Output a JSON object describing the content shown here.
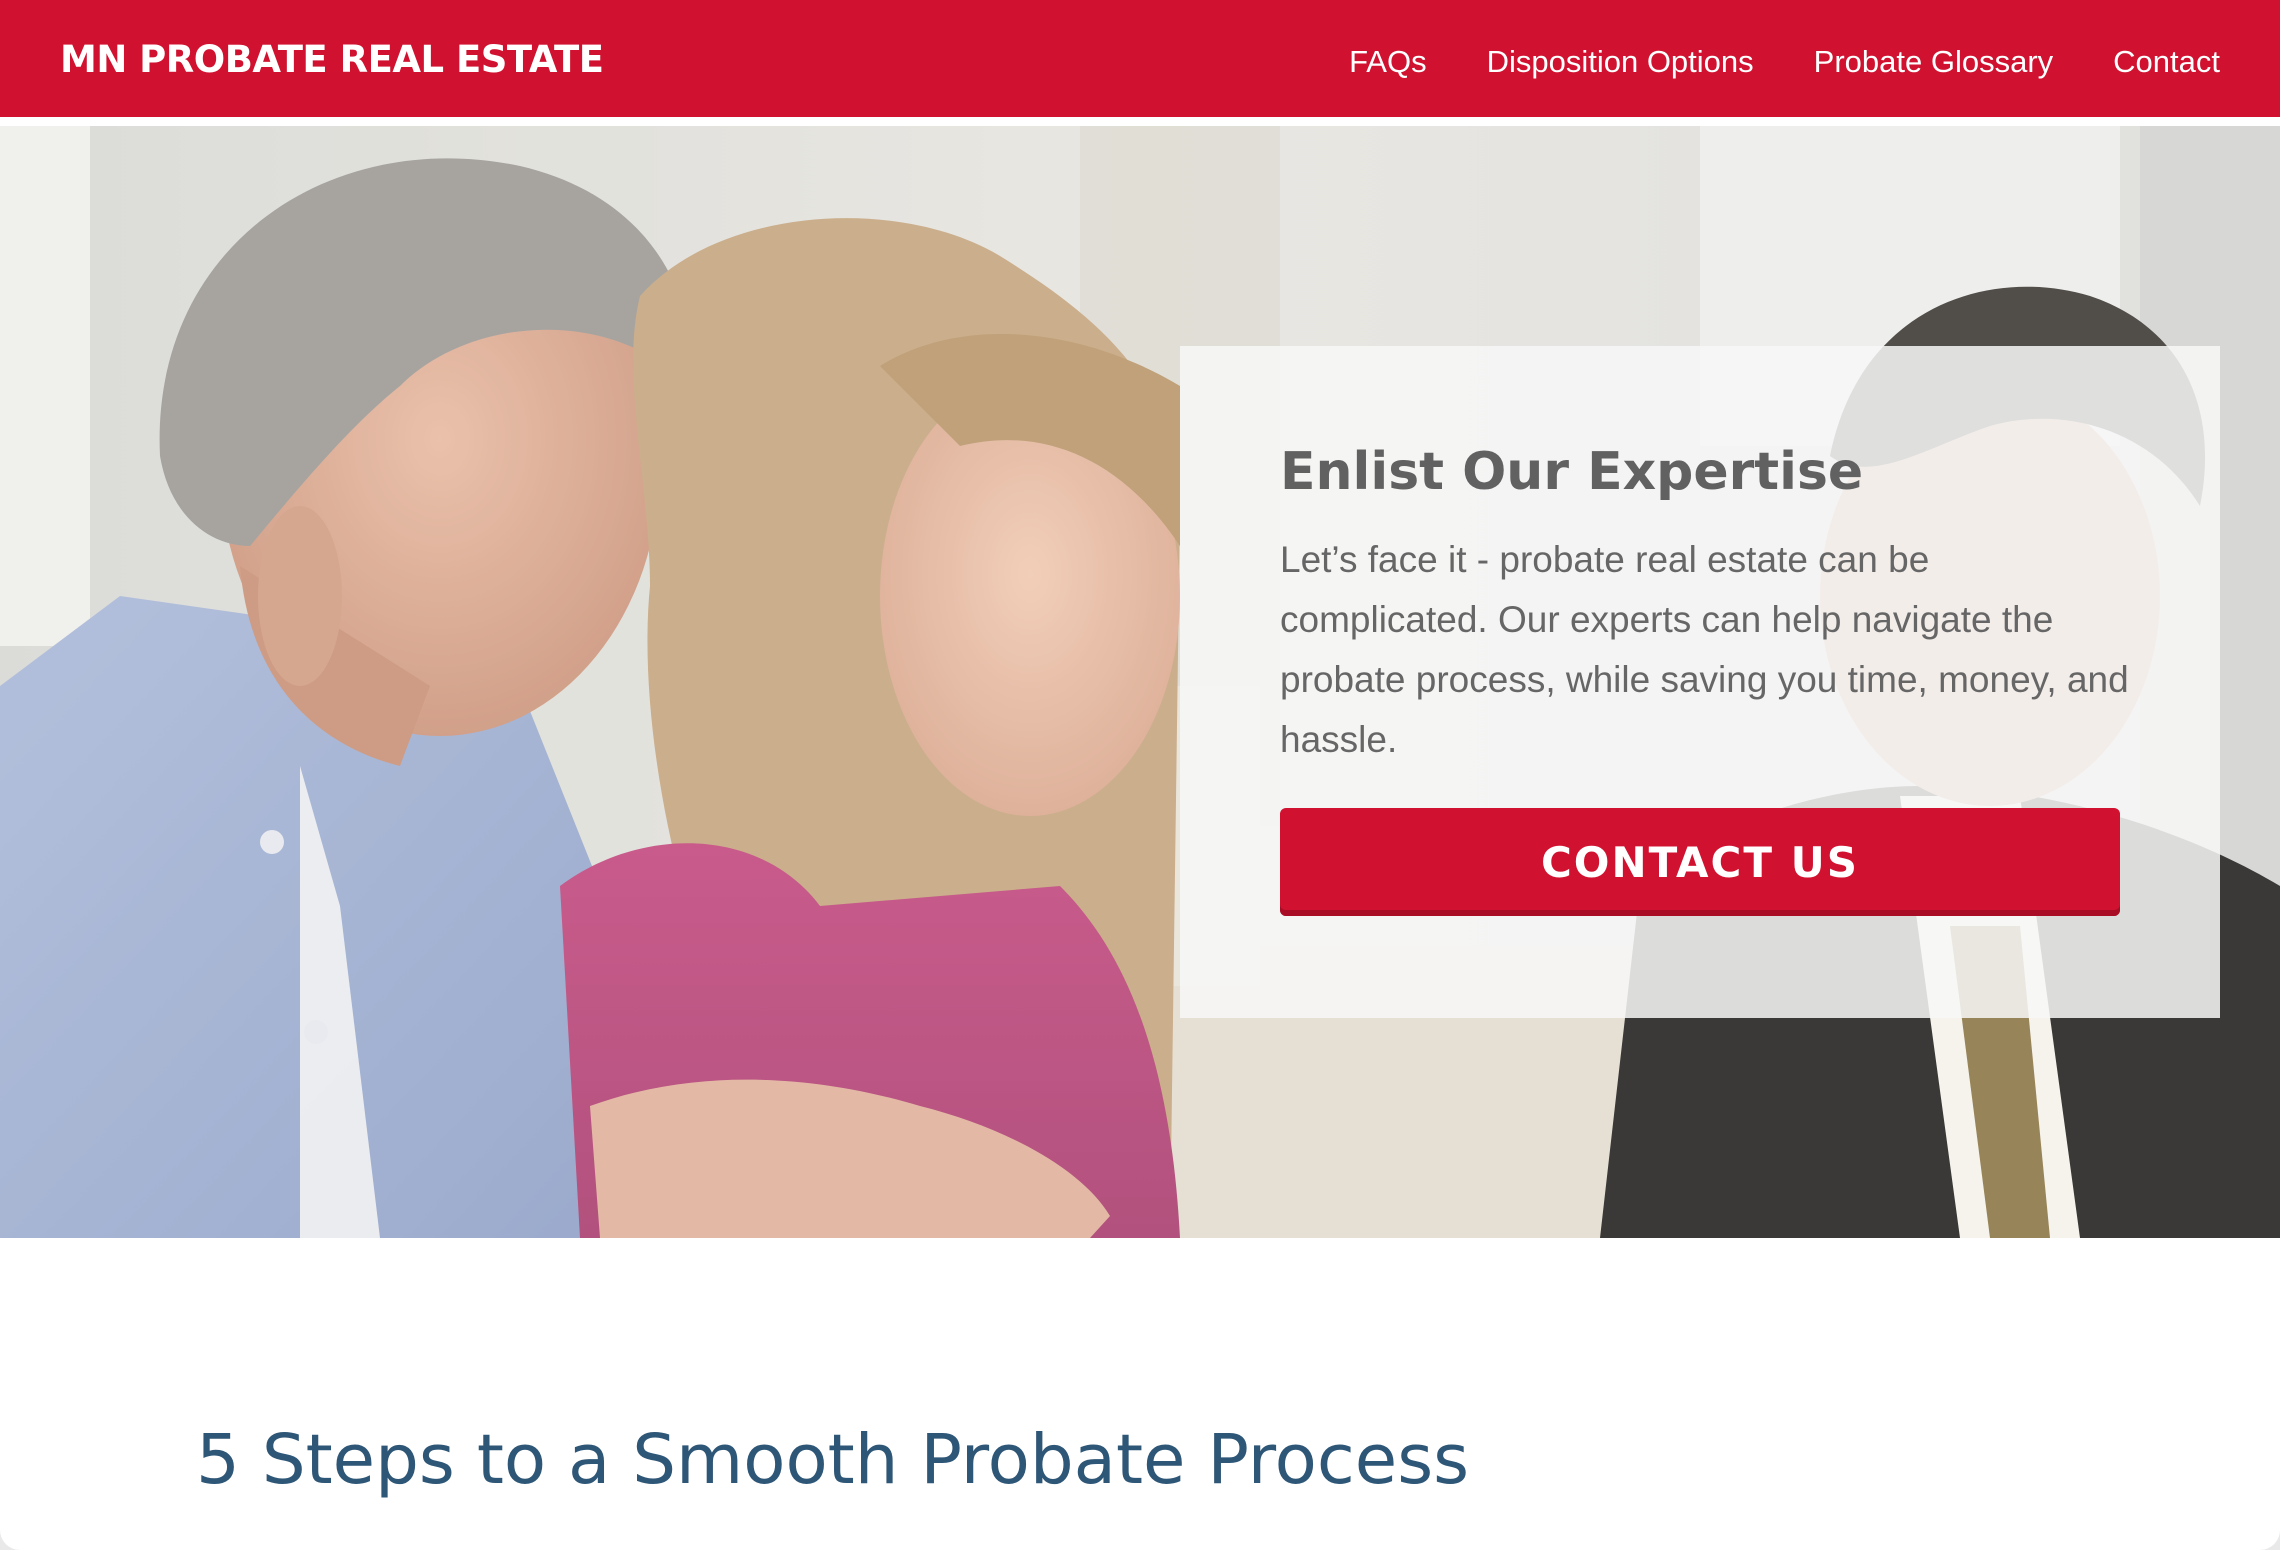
{
  "header": {
    "brand": "MN PROBATE REAL ESTATE",
    "nav": [
      {
        "label": "FAQs"
      },
      {
        "label": "Disposition Options"
      },
      {
        "label": "Probate Glossary"
      },
      {
        "label": "Contact"
      }
    ]
  },
  "hero": {
    "title": "Enlist Our Expertise",
    "text": "Let’s face it - probate real estate can be complicated. Our experts can help navigate the probate process, while saving you time, money, and hassle.",
    "button_label": "CONTACT US"
  },
  "steps": {
    "heading": "5 Steps to a Smooth Probate Process"
  },
  "colors": {
    "brand_red": "#d01230",
    "heading_blue": "#2e5676",
    "card_text": "#666666"
  }
}
